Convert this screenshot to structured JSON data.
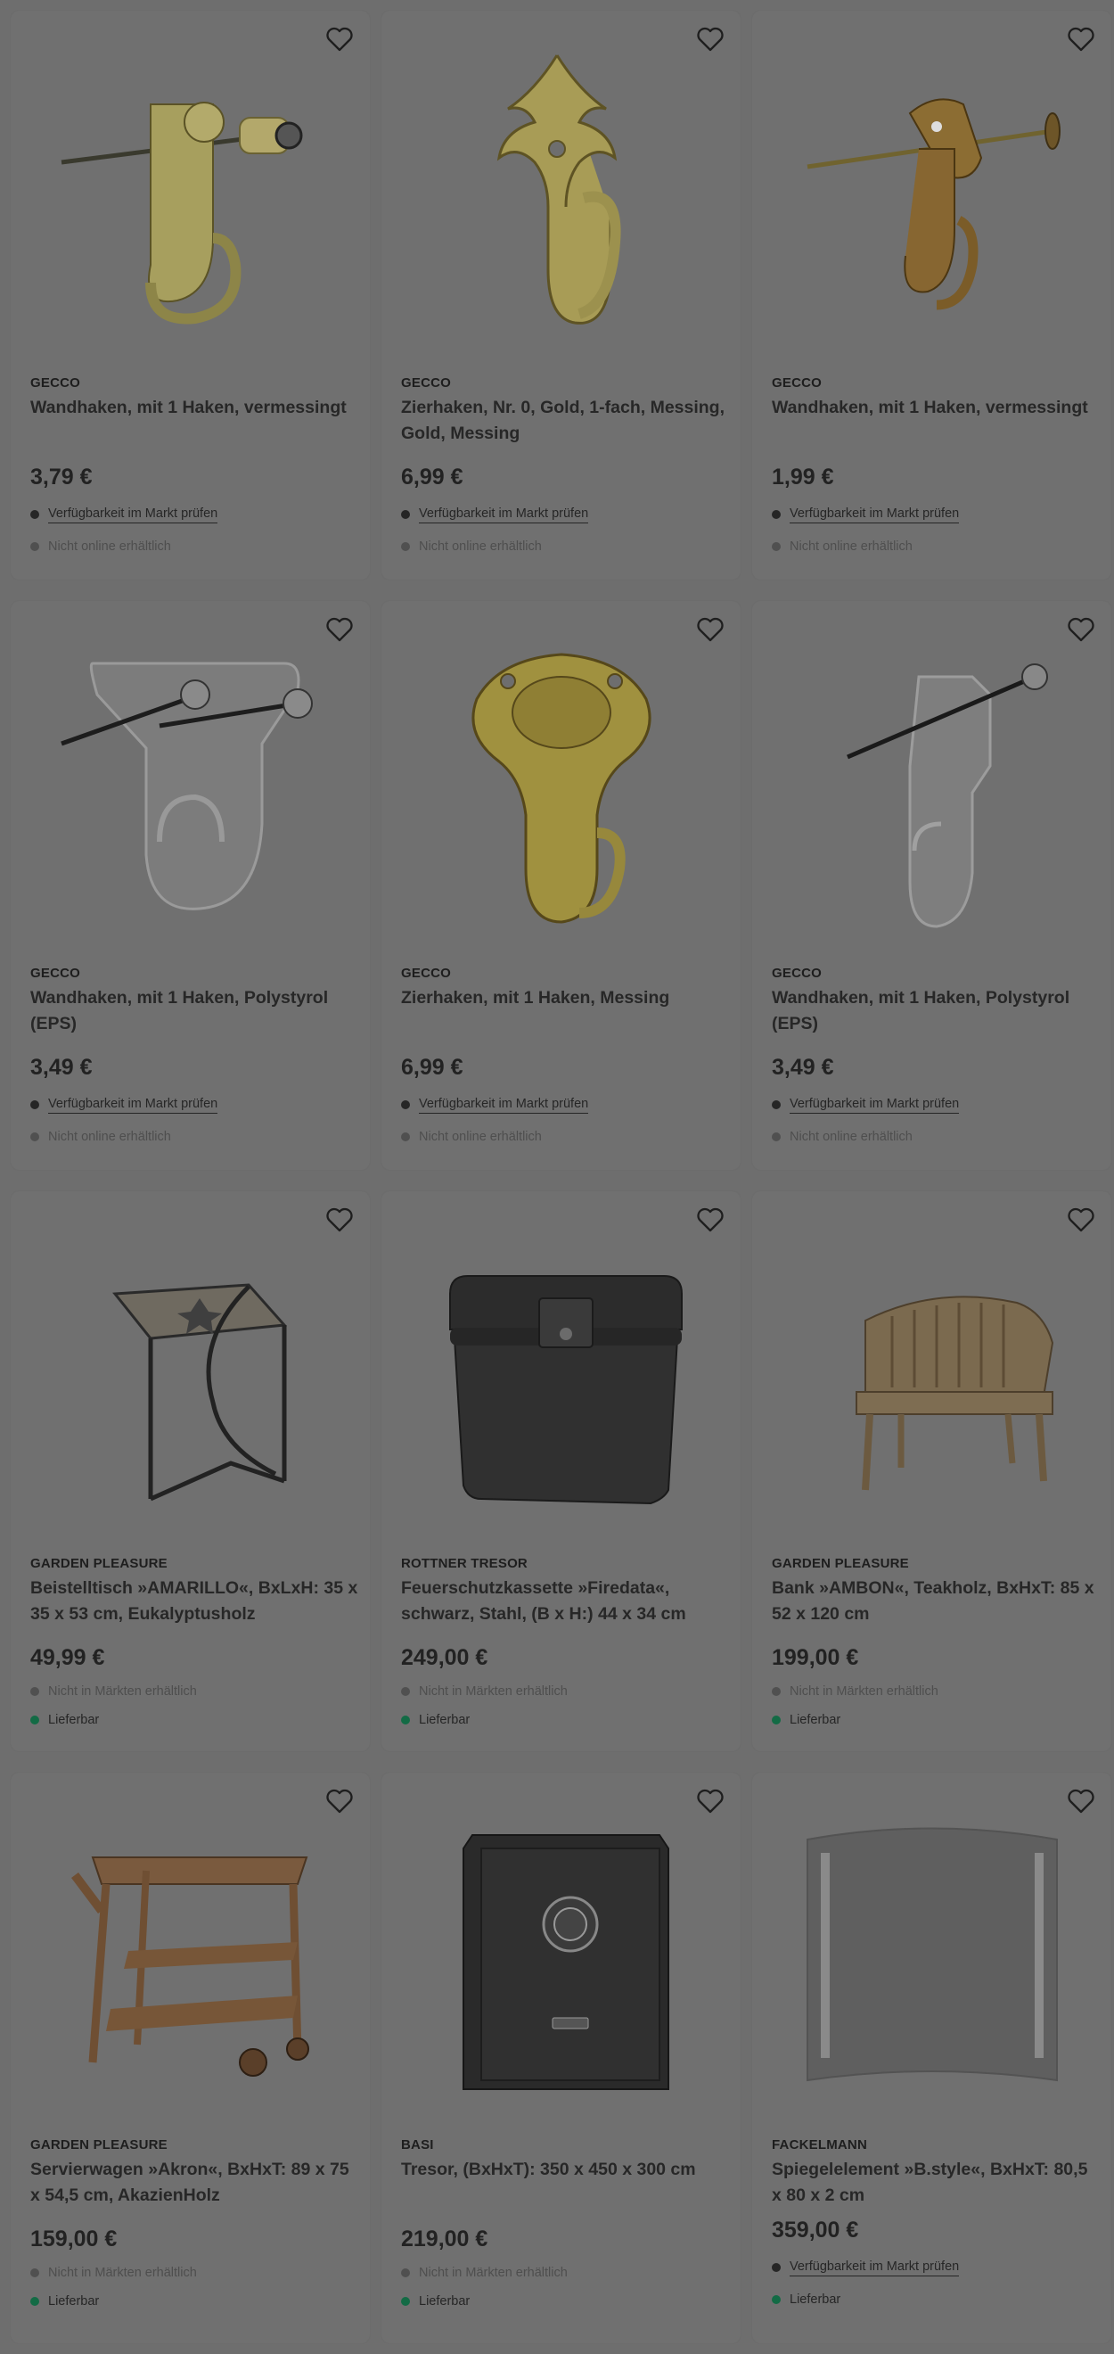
{
  "products": [
    {
      "brand": "GECCO",
      "title": "Wandhaken, mit 1 Haken, vermessingt",
      "price": "3,79 €",
      "status1": "Verfügbarkeit im Markt prüfen",
      "status2": "Nicht online erhältlich"
    },
    {
      "brand": "GECCO",
      "title": "Zierhaken, Nr. 0, Gold, 1-fach, Messing, Gold, Messing",
      "price": "6,99 €",
      "status1": "Verfügbarkeit im Markt prüfen",
      "status2": "Nicht online erhältlich"
    },
    {
      "brand": "GECCO",
      "title": "Wandhaken, mit 1 Haken, vermessingt",
      "price": "1,99 €",
      "status1": "Verfügbarkeit im Markt prüfen",
      "status2": "Nicht online erhältlich"
    },
    {
      "brand": "GECCO",
      "title": "Wandhaken, mit 1 Haken, Polystyrol (EPS)",
      "price": "3,49 €",
      "status1": "Verfügbarkeit im Markt prüfen",
      "status2": "Nicht online erhältlich"
    },
    {
      "brand": "GECCO",
      "title": "Zierhaken, mit 1 Haken, Messing",
      "price": "6,99 €",
      "status1": "Verfügbarkeit im Markt prüfen",
      "status2": "Nicht online erhältlich"
    },
    {
      "brand": "GECCO",
      "title": "Wandhaken, mit 1 Haken, Polystyrol (EPS)",
      "price": "3,49 €",
      "status1": "Verfügbarkeit im Markt prüfen",
      "status2": "Nicht online erhältlich"
    },
    {
      "brand": "GARDEN PLEASURE",
      "title": "Beistelltisch »AMARILLO«, BxLxH: 35 x 35 x 53 cm, Eukalyptusholz",
      "price": "49,99 €",
      "status1": "Nicht in Märkten erhältlich",
      "status2": "Lieferbar"
    },
    {
      "brand": "ROTTNER TRESOR",
      "title": "Feuerschutzkassette »Firedata«, schwarz, Stahl, (B x H:) 44 x 34 cm",
      "price": "249,00 €",
      "status1": "Nicht in Märkten erhältlich",
      "status2": "Lieferbar"
    },
    {
      "brand": "GARDEN PLEASURE",
      "title": "Bank »AMBON«, Teakholz, BxHxT: 85 x 52 x 120 cm",
      "price": "199,00 €",
      "status1": "Nicht in Märkten erhältlich",
      "status2": "Lieferbar"
    },
    {
      "brand": "GARDEN PLEASURE",
      "title": "Servierwagen »Akron«, BxHxT: 89 x 75 x 54,5 cm, AkazienHolz",
      "price": "159,00 €",
      "status1": "Nicht in Märkten erhältlich",
      "status2": "Lieferbar"
    },
    {
      "brand": "BASI",
      "title": "Tresor, (BxHxT): 350 x 450 x 300 cm",
      "price": "219,00 €",
      "status1": "Nicht in Märkten erhältlich",
      "status2": "Lieferbar"
    },
    {
      "brand": "FACKELMANN",
      "title": "Spiegelelement »B.style«, BxHxT: 80,5 x 80 x 2 cm",
      "price": "359,00 €",
      "status1": "Verfügbarkeit im Markt prüfen",
      "status2": "Lieferbar"
    }
  ],
  "icons": {
    "favorite": "heart-outline-icon",
    "status_dot": "dot-icon"
  },
  "colors": {
    "available": "#136b45",
    "unavailable": "#505050",
    "link": "#262626"
  }
}
